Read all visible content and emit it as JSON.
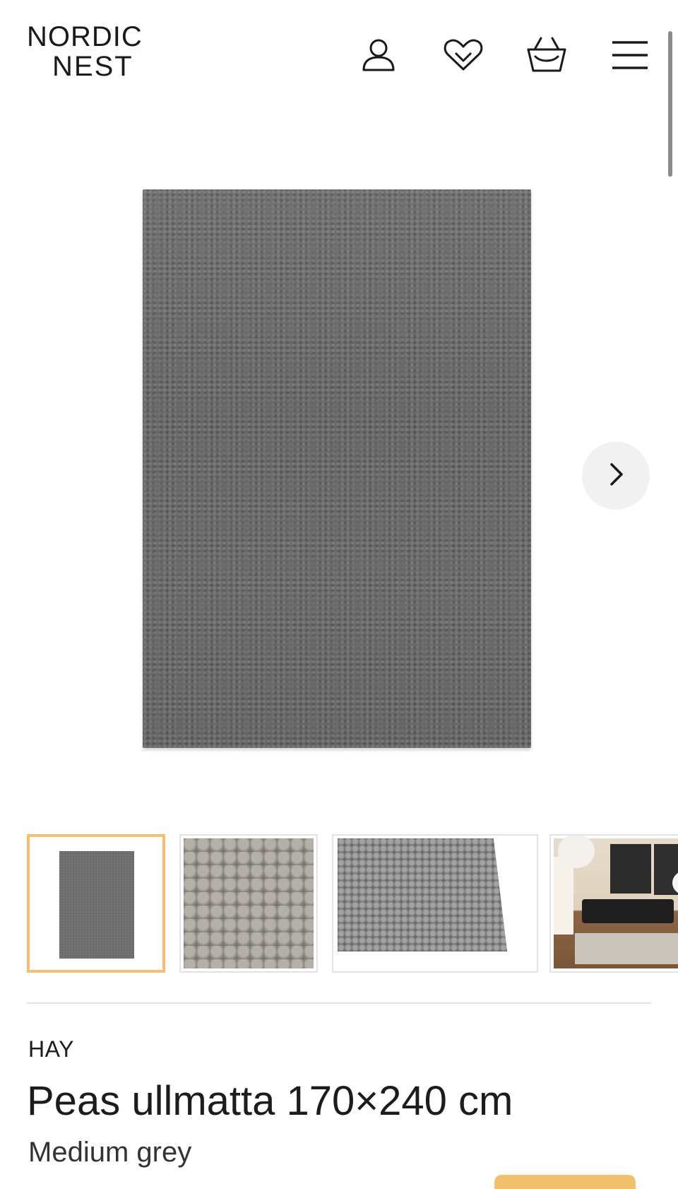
{
  "header": {
    "logo_line1": "NORDIC",
    "logo_line2": "NEST",
    "icons": [
      "account-icon",
      "wishlist-heart-icon",
      "basket-icon",
      "menu-icon"
    ]
  },
  "gallery": {
    "main_image_alt": "Peas ullmatta 170×240 cm",
    "next_icon": "chevron-right-icon",
    "thumbnails": [
      {
        "name": "rug-front",
        "active": true
      },
      {
        "name": "texture-closeup",
        "active": false
      },
      {
        "name": "edge-detail",
        "active": false
      },
      {
        "name": "room-setting",
        "active": false
      }
    ]
  },
  "product": {
    "brand": "HAY",
    "title": "Peas ullmatta 170×240 cm",
    "variant": "Medium grey"
  },
  "colors": {
    "accent": "#f3c06f",
    "text": "#1c1c1c",
    "rug": "#6b6b6b"
  }
}
